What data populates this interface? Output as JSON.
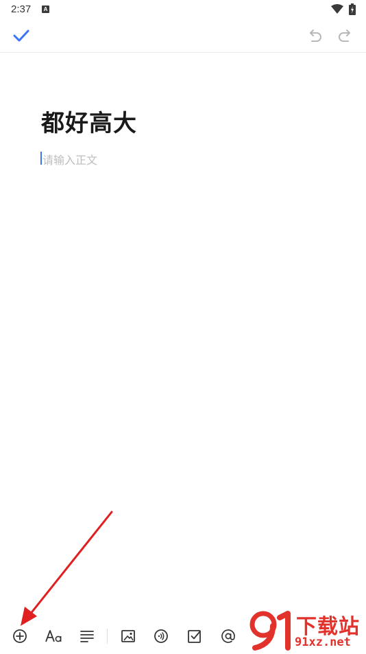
{
  "status_bar": {
    "time": "2:37",
    "notification_letter": "A"
  },
  "editor": {
    "title": "都好高大",
    "body_placeholder": "请输入正文"
  },
  "toolbar": {
    "items": [
      "add-icon",
      "text-format-icon",
      "align-icon",
      "image-icon",
      "audio-icon",
      "checklist-icon",
      "mention-icon"
    ]
  },
  "watermark": {
    "brand": "下载站",
    "url": "91xz.net"
  },
  "colors": {
    "accent": "#3b73f5",
    "annotation_arrow": "#e02020",
    "watermark": "#e1322c"
  }
}
